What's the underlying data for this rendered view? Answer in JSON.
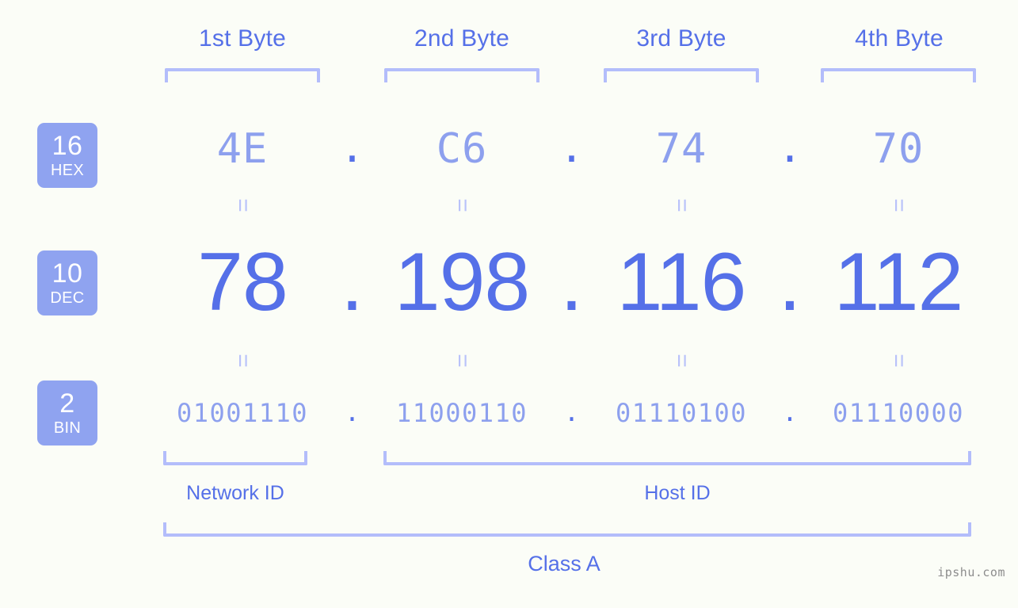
{
  "background_color": "#fbfdf7",
  "accent_color": "#5570e8",
  "accent_light_color": "#8da0ee",
  "bracket_color": "#b3bdfb",
  "badge_color": "#8fa3f0",
  "header": {
    "byte_labels": [
      "1st Byte",
      "2nd Byte",
      "3rd Byte",
      "4th Byte"
    ]
  },
  "rows": {
    "hex": {
      "badge_num": "16",
      "badge_name": "HEX",
      "values": [
        "4E",
        "C6",
        "74",
        "70"
      ],
      "separator": "."
    },
    "dec": {
      "badge_num": "10",
      "badge_name": "DEC",
      "values": [
        "78",
        "198",
        "116",
        "112"
      ],
      "separator": "."
    },
    "bin": {
      "badge_num": "2",
      "badge_name": "BIN",
      "values": [
        "01001110",
        "11000110",
        "01110100",
        "01110000"
      ],
      "separator": "."
    }
  },
  "equals_glyph": "=",
  "footer": {
    "network_id_label": "Network ID",
    "host_id_label": "Host ID",
    "class_label": "Class A"
  },
  "watermark": "ipshu.com"
}
